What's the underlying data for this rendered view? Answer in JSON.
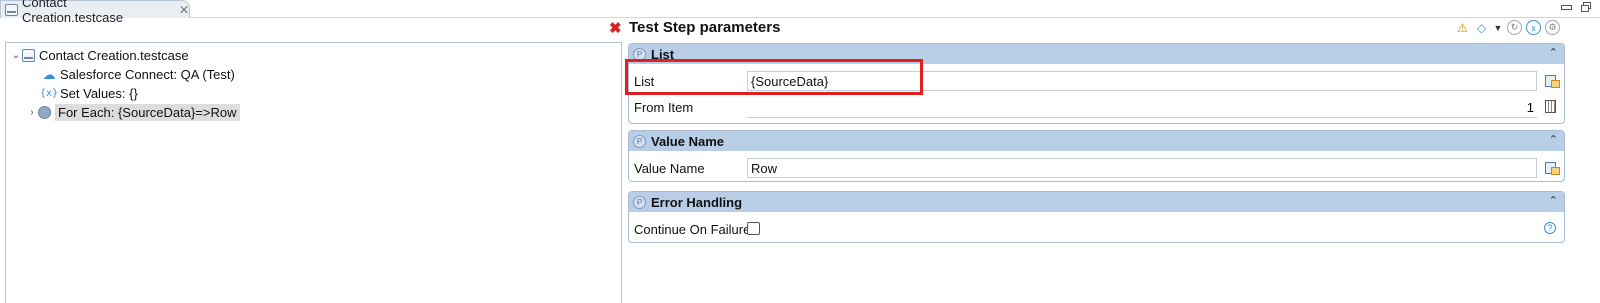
{
  "tab": {
    "title": "Contact Creation.testcase",
    "close": "✕"
  },
  "tree": {
    "root": "Contact Creation.testcase",
    "items": [
      {
        "label": "Salesforce Connect: QA (Test)"
      },
      {
        "label": "Set Values: {}"
      },
      {
        "label": "For Each: {SourceData}=>Row"
      }
    ]
  },
  "params": {
    "title": "Test Step parameters",
    "sections": {
      "list": {
        "title": "List",
        "list_label": "List",
        "list_value": "{SourceData}",
        "from_item_label": "From Item",
        "from_item_value": "1"
      },
      "value_name": {
        "title": "Value Name",
        "label": "Value Name",
        "value": "Row"
      },
      "error_handling": {
        "title": "Error Handling",
        "label": "Continue On Failure",
        "checked": false
      }
    }
  },
  "icons": {
    "error": "close-x-icon",
    "warning": "warning-icon",
    "tag": "tag-icon"
  },
  "colors": {
    "section_header": "#b8cde6",
    "highlight": "#e02020",
    "error": "#d32424"
  }
}
